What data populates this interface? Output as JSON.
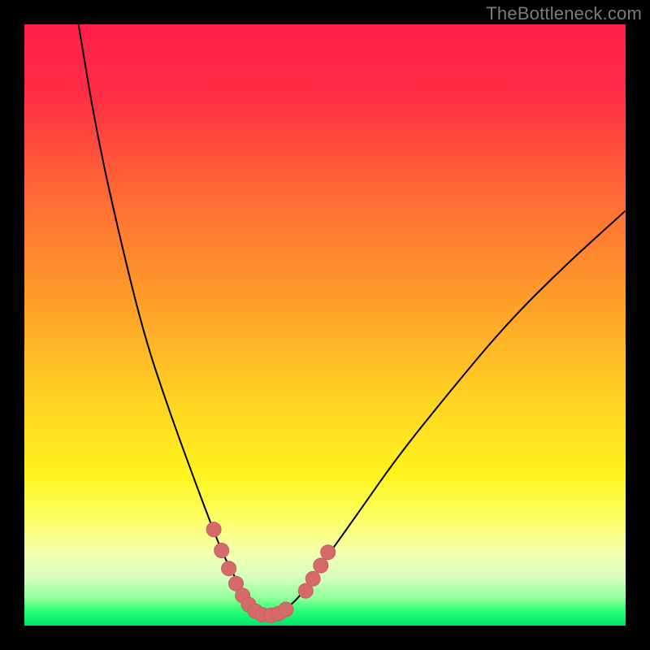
{
  "watermark": "TheBottleneck.com",
  "colors": {
    "frame": "#000000",
    "gradient_stops": [
      {
        "offset": 0.0,
        "color": "#ff1e4a"
      },
      {
        "offset": 0.12,
        "color": "#ff2f46"
      },
      {
        "offset": 0.28,
        "color": "#ff6a35"
      },
      {
        "offset": 0.45,
        "color": "#ff9a2a"
      },
      {
        "offset": 0.62,
        "color": "#ffd223"
      },
      {
        "offset": 0.75,
        "color": "#fff41f"
      },
      {
        "offset": 0.82,
        "color": "#fdff63"
      },
      {
        "offset": 0.88,
        "color": "#f4ffb0"
      },
      {
        "offset": 0.92,
        "color": "#d6ffbf"
      },
      {
        "offset": 0.955,
        "color": "#8dff9a"
      },
      {
        "offset": 0.975,
        "color": "#2bff74"
      },
      {
        "offset": 1.0,
        "color": "#00e56a"
      }
    ],
    "curve": "#000000",
    "marker_fill": "#d46a6a",
    "marker_stroke": "#c85d5d"
  },
  "chart_data": {
    "type": "line",
    "title": "",
    "xlabel": "",
    "ylabel": "",
    "xlim": [
      0,
      100
    ],
    "ylim": [
      0,
      100
    ],
    "grid": false,
    "legend": false,
    "note": "Axes are unlabeled; values are read as percent of plot width/height. y is proximity-to-bottom (0=top,100=bottom). Curve is a V-shape with minimum around x≈40.",
    "series": [
      {
        "name": "bottleneck-curve",
        "x": [
          9,
          12,
          16,
          20,
          24,
          28,
          31,
          33,
          35,
          37,
          38.5,
          40,
          41.5,
          43,
          45,
          47,
          50,
          55,
          62,
          70,
          80,
          90,
          100
        ],
        "y": [
          0,
          18,
          36,
          52,
          64,
          75,
          83,
          88,
          92,
          95,
          97,
          98,
          98,
          97.5,
          96,
          93.5,
          89,
          82,
          72,
          62,
          50,
          40,
          31
        ]
      }
    ],
    "markers": {
      "name": "highlight-dots",
      "note": "Pink rounded markers clustered near the valley bottom on both flanks.",
      "points": [
        {
          "x": 31.5,
          "y": 84
        },
        {
          "x": 32.8,
          "y": 87.5
        },
        {
          "x": 34.0,
          "y": 90.5
        },
        {
          "x": 35.2,
          "y": 93
        },
        {
          "x": 36.3,
          "y": 95
        },
        {
          "x": 37.3,
          "y": 96.5
        },
        {
          "x": 38.4,
          "y": 97.6
        },
        {
          "x": 39.6,
          "y": 98.2
        },
        {
          "x": 41.0,
          "y": 98.3
        },
        {
          "x": 42.3,
          "y": 98.0
        },
        {
          "x": 43.5,
          "y": 97.3
        },
        {
          "x": 46.8,
          "y": 94.2
        },
        {
          "x": 48.0,
          "y": 92.2
        },
        {
          "x": 49.3,
          "y": 90.0
        },
        {
          "x": 50.5,
          "y": 87.8
        }
      ],
      "r": 9
    }
  }
}
